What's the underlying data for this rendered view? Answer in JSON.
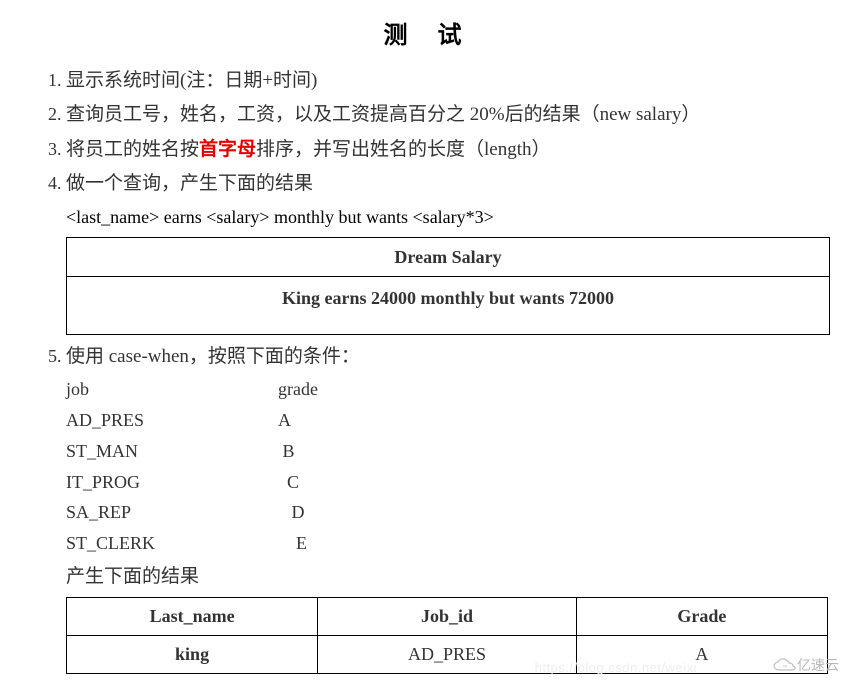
{
  "title": "测 试",
  "items": {
    "q1": "显示系统时间(注：日期+时间)",
    "q2": "查询员工号，姓名，工资，以及工资提高百分之 20%后的结果（new salary）",
    "q3_a": "将员工的姓名按",
    "q3_highlight": "首字母",
    "q3_b": "排序，并写出姓名的长度（length）",
    "q4": "做一个查询，产生下面的结果",
    "q4_formula": "<last_name> earns <salary> monthly but wants <salary*3>",
    "q4_header": "Dream Salary",
    "q4_row": "King earns 24000 monthly but wants 72000",
    "q5": "使用 case-when，按照下面的条件：",
    "q5_grade_header_job": "job",
    "q5_grade_header_grade": "grade",
    "q5_grades": [
      {
        "job": "AD_PRES",
        "grade": "A"
      },
      {
        "job": "ST_MAN",
        "grade": " B"
      },
      {
        "job": "IT_PROG",
        "grade": "  C"
      },
      {
        "job": "SA_REP",
        "grade": "   D"
      },
      {
        "job": "ST_CLERK",
        "grade": "    E"
      }
    ],
    "q5_result_text": "产生下面的结果",
    "q5_table_headers": [
      "Last_name",
      "Job_id",
      "Grade"
    ],
    "q5_table_row": [
      "king",
      "AD_PRES",
      "A"
    ]
  },
  "watermark": {
    "brand": "亿速云",
    "faint": "https://blog.csdn.net/weixi"
  }
}
